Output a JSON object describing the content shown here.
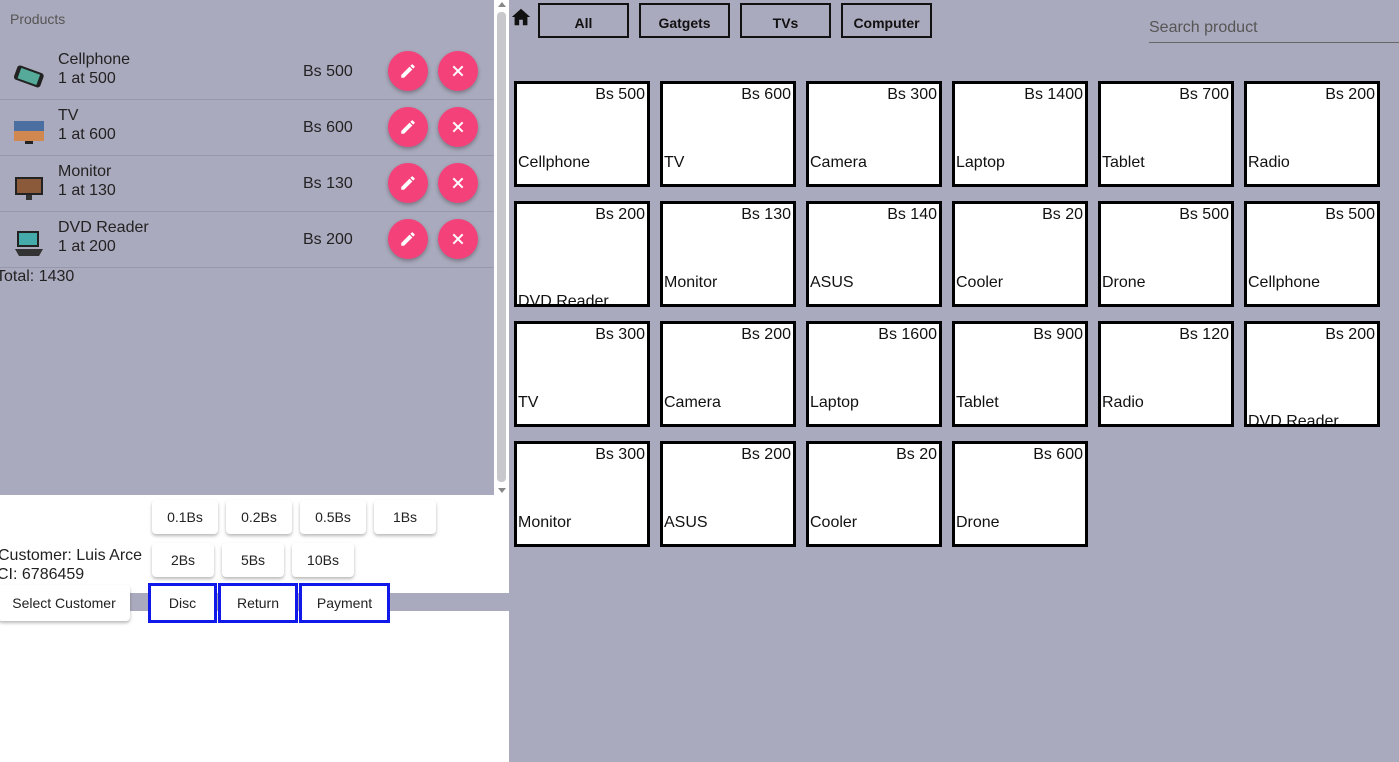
{
  "cart": {
    "title": "Products",
    "items": [
      {
        "name": "Cellphone",
        "qty": "1 at 500",
        "price": "Bs 500",
        "icon": "cellphone"
      },
      {
        "name": "TV",
        "qty": "1 at 600",
        "price": "Bs 600",
        "icon": "tv"
      },
      {
        "name": "Monitor",
        "qty": "1 at 130",
        "price": "Bs 130",
        "icon": "monitor"
      },
      {
        "name": "DVD Reader",
        "qty": "1 at 200",
        "price": "Bs 200",
        "icon": "dvd"
      }
    ],
    "total": "Total: 1430"
  },
  "money": [
    "0.1Bs",
    "0.2Bs",
    "0.5Bs",
    "1Bs",
    "2Bs",
    "5Bs",
    "10Bs"
  ],
  "customer": {
    "name": "Customer: Luis Arce",
    "ci": "CI: 6786459",
    "select_label": "Select Customer"
  },
  "actions": {
    "disc": "Disc",
    "return": "Return",
    "payment": "Payment"
  },
  "categories": [
    "All",
    "Gatgets",
    "TVs",
    "Computer"
  ],
  "search": {
    "placeholder": "Search product",
    "value": ""
  },
  "products": [
    {
      "name": "Cellphone",
      "price": "Bs 500",
      "art": "cellphone"
    },
    {
      "name": "TV",
      "price": "Bs 600",
      "art": "tv"
    },
    {
      "name": "Camera",
      "price": "Bs 300",
      "art": "camera"
    },
    {
      "name": "Laptop",
      "price": "Bs 1400",
      "art": "laptop"
    },
    {
      "name": "Tablet",
      "price": "Bs 700",
      "art": "tablet"
    },
    {
      "name": "Radio",
      "price": "Bs 200",
      "art": "radio"
    },
    {
      "name": "DVD Reader",
      "price": "Bs 200",
      "art": "dvd"
    },
    {
      "name": "Monitor",
      "price": "Bs 130",
      "art": "monitor"
    },
    {
      "name": "ASUS",
      "price": "Bs 140",
      "art": "asus"
    },
    {
      "name": "Cooler",
      "price": "Bs 20",
      "art": "cooler"
    },
    {
      "name": "Drone",
      "price": "Bs 500",
      "art": "drone"
    },
    {
      "name": "Cellphone",
      "price": "Bs 500",
      "art": "cellphone"
    },
    {
      "name": "TV",
      "price": "Bs 300",
      "art": "tv"
    },
    {
      "name": "Camera",
      "price": "Bs 200",
      "art": "camera"
    },
    {
      "name": "Laptop",
      "price": "Bs 1600",
      "art": "laptop"
    },
    {
      "name": "Tablet",
      "price": "Bs 900",
      "art": "tablet"
    },
    {
      "name": "Radio",
      "price": "Bs 120",
      "art": "radio"
    },
    {
      "name": "DVD Reader",
      "price": "Bs 200",
      "art": "dvd"
    },
    {
      "name": "Monitor",
      "price": "Bs 300",
      "art": "monitor"
    },
    {
      "name": "ASUS",
      "price": "Bs 200",
      "art": "asus"
    },
    {
      "name": "Cooler",
      "price": "Bs 20",
      "art": "cooler"
    },
    {
      "name": "Drone",
      "price": "Bs 600",
      "art": "drone"
    }
  ],
  "colors": {
    "background": "#aaaabe",
    "fab": "#f4417a",
    "action_border": "#1019e8"
  }
}
